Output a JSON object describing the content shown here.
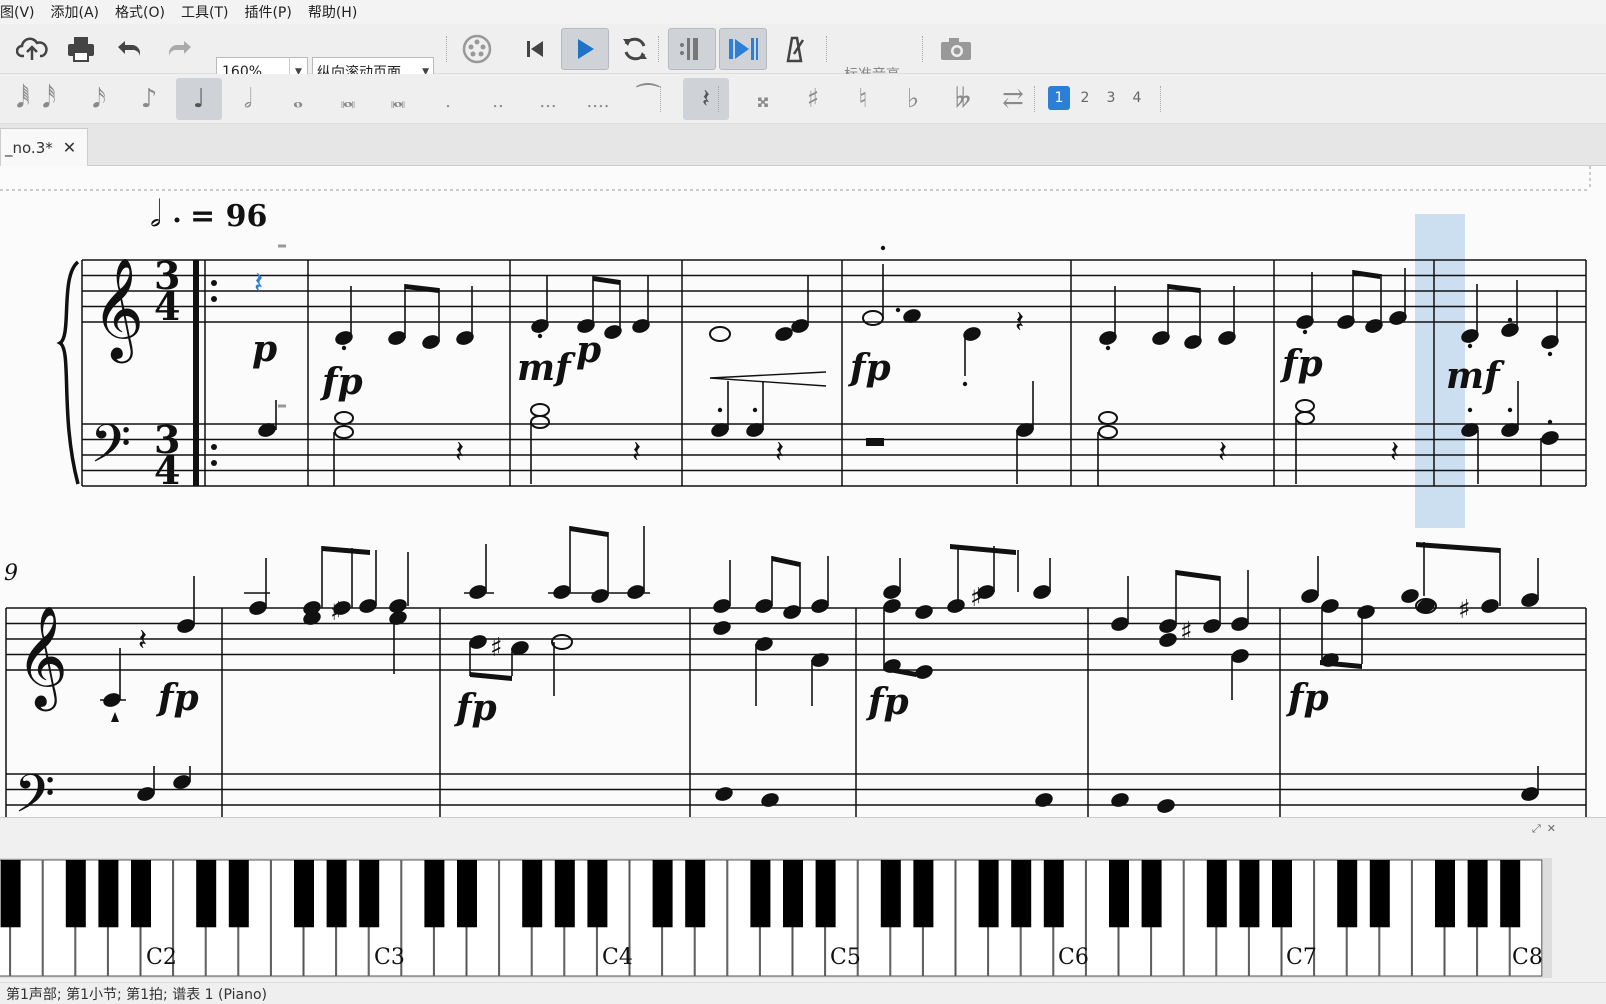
{
  "menu": [
    {
      "label": "图(V)",
      "name": "menu-view"
    },
    {
      "label": "添加(A)",
      "name": "menu-add"
    },
    {
      "label": "格式(O)",
      "name": "menu-format"
    },
    {
      "label": "工具(T)",
      "name": "menu-tools"
    },
    {
      "label": "插件(P)",
      "name": "menu-plugins"
    },
    {
      "label": "帮助(H)",
      "name": "menu-help"
    }
  ],
  "toolbar": {
    "zoom_value": "160%",
    "view_mode": "纵向滚动页面",
    "concert_pitch_label": "标准音高"
  },
  "note_input": {
    "voices": [
      "1",
      "2",
      "3",
      "4"
    ],
    "active_voice": "1"
  },
  "tab": {
    "title": "_no.3*",
    "close": "✕"
  },
  "score": {
    "tempo_text": "= 96",
    "time_signature": "3/4",
    "system2_measure_number": "9",
    "dynamics_system1": [
      "p",
      "fp",
      "mf",
      "p",
      "fp",
      "fp",
      "mf"
    ],
    "dynamics_system2": [
      "fp",
      "fp",
      "fp",
      "fp"
    ]
  },
  "piano": {
    "octave_labels": [
      "C2",
      "C3",
      "C4",
      "C5",
      "C6",
      "C7",
      "C8"
    ],
    "panel_buttons": [
      "⤢",
      "✕"
    ]
  },
  "status": {
    "text": "第1声部;  第1小节; 第1拍; 谱表 1 (Piano)"
  },
  "colors": {
    "accent": "#2c7fd6",
    "selection": "#c6dbef",
    "play": "#1e73c9"
  }
}
